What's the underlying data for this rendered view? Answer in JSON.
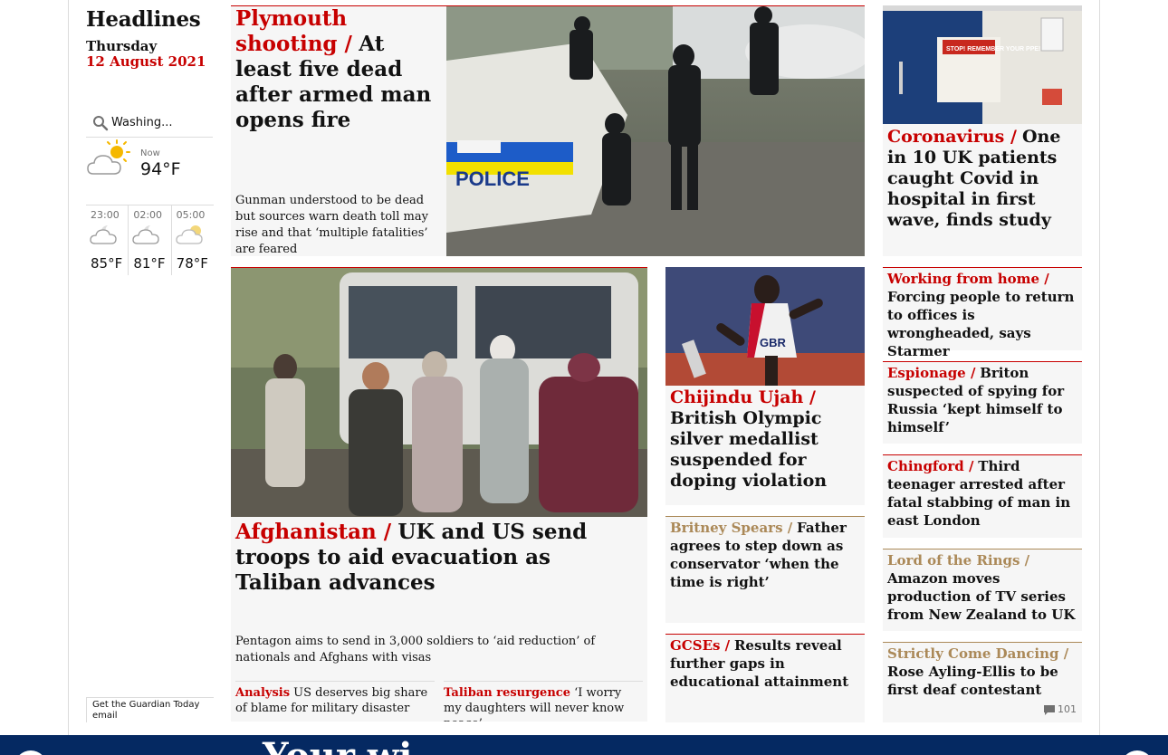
{
  "section": {
    "title": "Headlines",
    "day": "Thursday",
    "date": "12 August 2021"
  },
  "weather": {
    "location": "Washing...",
    "now_label": "Now",
    "now_temp": "94°F",
    "forecast": [
      {
        "time": "23:00",
        "temp": "85°F"
      },
      {
        "time": "02:00",
        "temp": "81°F"
      },
      {
        "time": "05:00",
        "temp": "78°F"
      }
    ]
  },
  "email_cta": "Get the Guardian Today email",
  "lead": {
    "kicker": "Plymouth shooting /",
    "headline": "At least five dead after armed man opens fire",
    "standfirst": "Gunman understood to be dead but sources warn death toll may rise and that ‘multiple fatalities’ are feared",
    "image_text": "POLICE"
  },
  "covid": {
    "kicker": "Coronavirus /",
    "headline": "One in 10 UK patients caught Covid in hospital in first wave, finds study",
    "image_text": "STOP! REMEMBER YOUR PPE!"
  },
  "afghanistan": {
    "kicker": "Afghanistan /",
    "headline": "UK and US send troops to aid evacuation as Taliban advances",
    "standfirst": "Pentagon aims to send in 3,000 soldiers to ‘aid reduction’ of nationals and Afghans with visas",
    "sublinks": [
      {
        "kicker": "Analysis",
        "text": "US deserves big share of blame for military disaster"
      },
      {
        "kicker": "Taliban resurgence",
        "text": "‘I worry my daughters will never know peace’"
      }
    ]
  },
  "ujah": {
    "kicker": "Chijindu Ujah /",
    "headline": "British Olympic silver medallist suspended for doping violation",
    "image_text": "GBR"
  },
  "middle_small": [
    {
      "kicker": "Britney Spears /",
      "headline": "Father agrees to step down as conservator ‘when the time is right’",
      "style": "gold"
    },
    {
      "kicker": "GCSEs /",
      "headline": "Results reveal further gaps in educational attainment",
      "style": "red"
    }
  ],
  "right_small": [
    {
      "kicker": "Working from home /",
      "headline": "Forcing people to return to offices is wrongheaded, says Starmer",
      "style": "red"
    },
    {
      "kicker": "Espionage /",
      "headline": "Briton suspected of spying for Russia ‘kept himself to himself’",
      "style": "red"
    },
    {
      "kicker": "Chingford /",
      "headline": "Third teenager arrested after fatal stabbing of man in east London",
      "style": "red"
    },
    {
      "kicker": "Lord of the Rings /",
      "headline": "Amazon moves production of TV series from New Zealand to UK",
      "style": "gold"
    },
    {
      "kicker": "Strictly Come Dancing /",
      "headline": "Rose Ayling-Ellis to be first deaf contestant",
      "style": "gold",
      "comments": "101"
    }
  ],
  "footer": {
    "brand": "Your wi"
  },
  "colors": {
    "news_red": "#c70000",
    "culture_gold": "#ab8958",
    "nav_blue": "#052962"
  }
}
